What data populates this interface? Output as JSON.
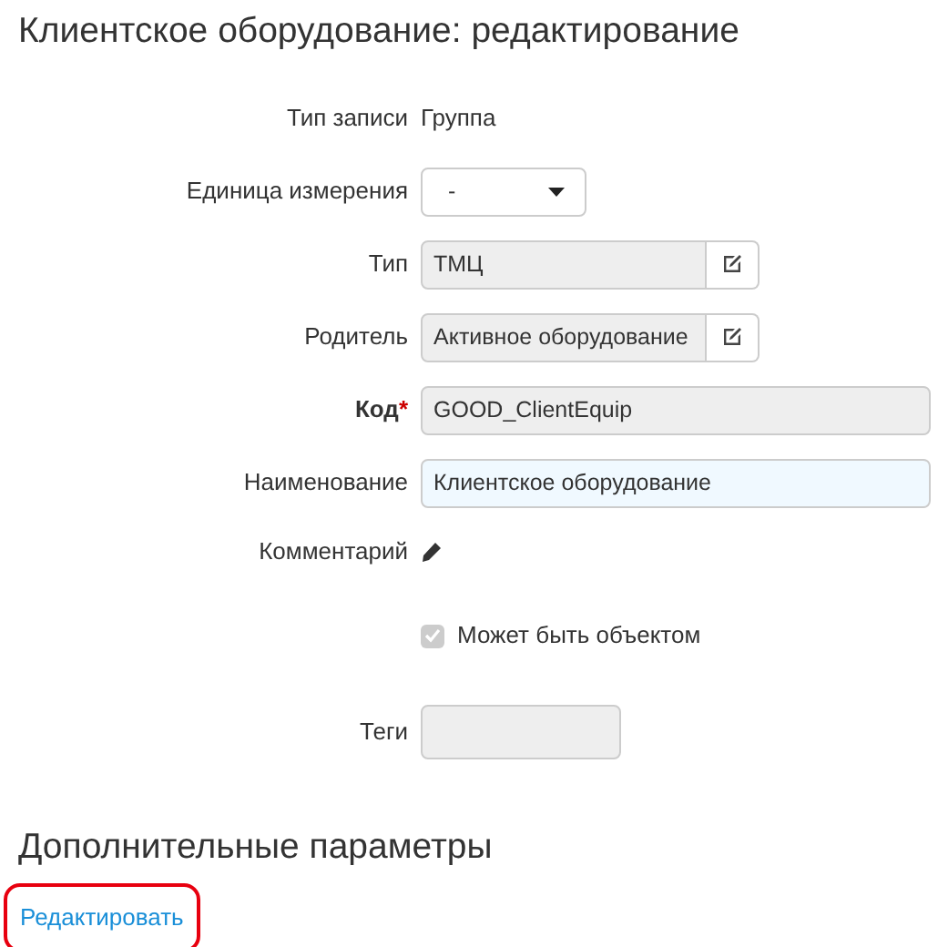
{
  "title": "Клиентское оборудование: редактирование",
  "fields": [
    {
      "kind": "static",
      "label": "Тип записи",
      "value": "Группа"
    },
    {
      "kind": "select",
      "label": "Единица измерения",
      "value": "-"
    },
    {
      "kind": "lookup",
      "label": "Тип",
      "value": "ТМЦ"
    },
    {
      "kind": "lookup",
      "label": "Родитель",
      "value": "Активное оборудование"
    },
    {
      "kind": "input",
      "label": "Код",
      "required_mark": "*",
      "value": "GOOD_ClientEquip",
      "disabled": true,
      "focused": false
    },
    {
      "kind": "input",
      "label": "Наименование",
      "value": "Клиентское оборудование",
      "disabled": false,
      "focused": true
    },
    {
      "kind": "comment",
      "label": "Комментарий"
    },
    {
      "kind": "checkbox",
      "label": "Может быть объектом",
      "checked": true,
      "disabled": true
    },
    {
      "kind": "tags",
      "label": "Теги",
      "disabled": true
    }
  ],
  "section": {
    "title": "Дополнительные параметры",
    "link": {
      "label": "Редактировать",
      "highlighted": true
    }
  }
}
